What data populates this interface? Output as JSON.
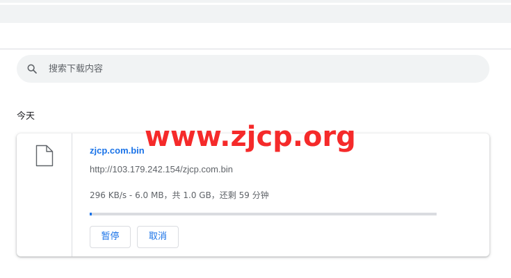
{
  "search": {
    "placeholder": "搜索下载内容",
    "value": ""
  },
  "downloads": {
    "date_group": "今天",
    "items": [
      {
        "file_name": "zjcp.com.bin",
        "url": "http://103.179.242.154/zjcp.com.bin",
        "status": "296 KB/s - 6.0 MB，共 1.0 GB，还剩 59 分钟",
        "progress_fraction": 0.006,
        "pause_label": "暂停",
        "cancel_label": "取消"
      }
    ]
  },
  "watermark": {
    "text": "www.zjcp.org",
    "color": "#f52a2a"
  },
  "colors": {
    "accent": "#1a73e8",
    "search_bg": "#f1f3f4",
    "divider": "#dadce0",
    "secondary_text": "#5f6368"
  },
  "icons": {
    "search": "search-icon",
    "file": "file-icon"
  }
}
